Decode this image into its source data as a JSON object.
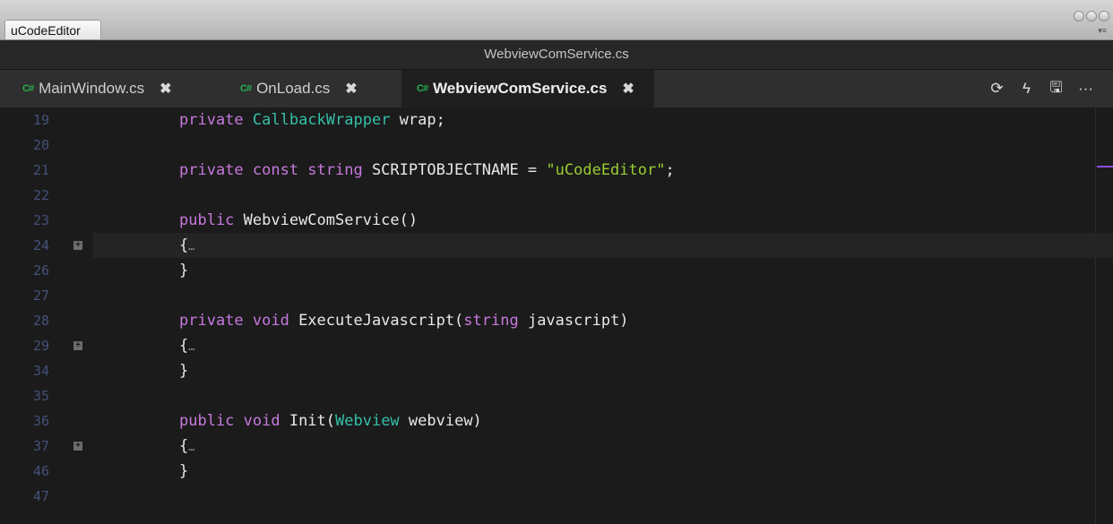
{
  "window": {
    "app_tab": "uCodeEditor",
    "menu_glyph": "▾≡",
    "file_title": "WebviewComService.cs"
  },
  "tabs": [
    {
      "icon": "C#",
      "label": "MainWindow.cs",
      "close": "✖"
    },
    {
      "icon": "C#",
      "label": "OnLoad.cs",
      "close": "✖"
    },
    {
      "icon": "C#",
      "label": "WebviewComService.cs",
      "close": "✖",
      "active": true
    }
  ],
  "toolbar": {
    "refresh_icon": "⟳",
    "run_icon": "ϟ",
    "save_icon": "🖫",
    "more_icon": "···"
  },
  "colors": {
    "keyword": "#c778dd",
    "type": "#35bfa8",
    "string": "#9acd32",
    "line_number": "#45517a",
    "minimap_marker": "#8d4fd8"
  },
  "editor": {
    "fold_glyph": "+",
    "lines": [
      {
        "num": "19",
        "p": [
          "private",
          " ",
          "CallbackWrapper",
          " wrap;"
        ]
      },
      {
        "num": "20"
      },
      {
        "num": "21",
        "p": [
          "private const string",
          " SCRIPTOBJECTNAME = ",
          "\"uCodeEditor\"",
          ";"
        ]
      },
      {
        "num": "22"
      },
      {
        "num": "23",
        "p": [
          "public",
          " WebviewComService()"
        ]
      },
      {
        "num": "24",
        "fold": true,
        "current": true,
        "p": [
          "{",
          "…"
        ]
      },
      {
        "num": "26",
        "p": [
          "}"
        ]
      },
      {
        "num": "27"
      },
      {
        "num": "28",
        "p": [
          "private void",
          " ExecuteJavascript(",
          "string",
          " javascript)"
        ]
      },
      {
        "num": "29",
        "fold": true,
        "p": [
          "{",
          "…"
        ]
      },
      {
        "num": "34",
        "p": [
          "}"
        ]
      },
      {
        "num": "35"
      },
      {
        "num": "36",
        "p": [
          "public void",
          " Init(",
          "Webview",
          " webview)"
        ]
      },
      {
        "num": "37",
        "fold": true,
        "p": [
          "{",
          "…"
        ]
      },
      {
        "num": "46",
        "p": [
          "}"
        ]
      },
      {
        "num": "47"
      }
    ]
  }
}
